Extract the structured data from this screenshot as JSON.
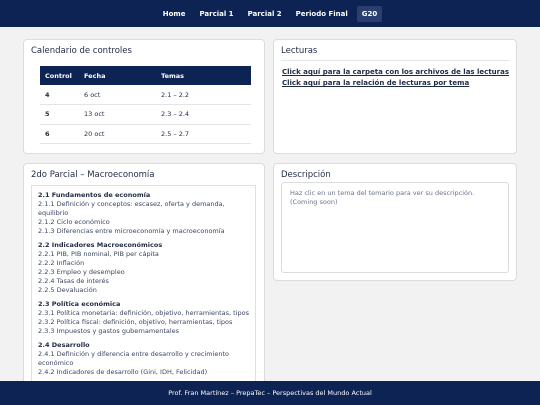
{
  "nav": {
    "items": [
      "Home",
      "Parcial 1",
      "Parcial 2",
      "Periodo Final",
      "G20"
    ],
    "active_index": 4
  },
  "calendar": {
    "title": "Calendario de controles",
    "headers": [
      "Control",
      "Fecha",
      "Temas"
    ],
    "rows": [
      {
        "control": "4",
        "fecha": "6 oct",
        "temas": "2.1 – 2.2"
      },
      {
        "control": "5",
        "fecha": "13 oct",
        "temas": "2.3 – 2.4"
      },
      {
        "control": "6",
        "fecha": "20 oct",
        "temas": "2.5 – 2.7"
      }
    ]
  },
  "lecturas": {
    "title": "Lecturas",
    "links": [
      "Click aquí para la carpeta con los archivos de las lecturas",
      "Click aquí para la relación de lecturas por tema"
    ]
  },
  "syllabus": {
    "title": "2do Parcial – Macroeconomía",
    "sections": [
      {
        "head": "2.1 Fundamentos de economía",
        "items": [
          "2.1.1 Definición y conceptos: escasez, oferta y demanda, equilibrio",
          "2.1.2 Ciclo económico",
          "2.1.3 Diferencias entre microeconomía y macroeconomía"
        ]
      },
      {
        "head": "2.2 Indicadores Macroeconómicos",
        "items": [
          "2.2.1 PIB, PIB nominal, PIB per cápita",
          "2.2.2 Inflación",
          "2.2.3 Empleo y desempleo",
          "2.2.4 Tasas de interés",
          "2.2.5 Devaluación"
        ]
      },
      {
        "head": "2.3 Política económica",
        "items": [
          "2.3.1 Política monetaria: definición, objetivo, herramientas, tipos",
          "2.3.2 Política fiscal: definición, objetivo, herramientas, tipos",
          "2.3.3 Impuestos y gastos gubernamentales"
        ]
      },
      {
        "head": "2.4 Desarrollo",
        "items": [
          "2.4.1 Definición y diferencia entre desarrollo y crecimiento económico",
          "2.4.2 Indicadores de desarrollo (Gini, IDH, Felicidad)"
        ]
      }
    ]
  },
  "descripcion": {
    "title": "Descripción",
    "text": "Haz clic en un tema del temario para ver su descripción. (Coming soon)"
  },
  "footer": {
    "text": "Prof. Fran Martínez – PrepaTec – Perspectivas del Mundo Actual"
  }
}
